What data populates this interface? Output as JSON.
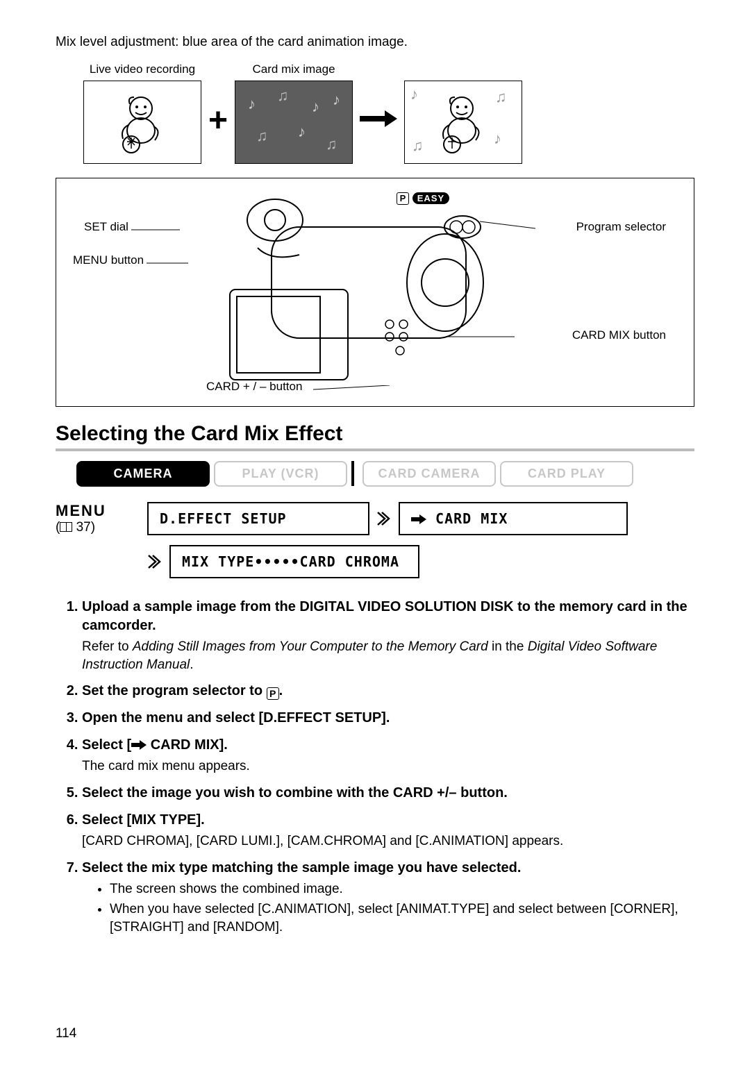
{
  "intro": "Mix level adjustment: blue area of the card animation image.",
  "illus": {
    "label1": "Live video recording",
    "label2": "Card mix image"
  },
  "cam_labels": {
    "set_dial": "SET dial",
    "menu_btn": "MENU button",
    "card_pm": "CARD + / – button",
    "prog_sel": "Program selector",
    "card_mix": "CARD MIX button",
    "p_badge": "P",
    "easy_badge": "EASY"
  },
  "section_heading": "Selecting the Card Mix Effect",
  "modes": {
    "camera": "CAMERA",
    "play": "PLAY (VCR)",
    "card_cam": "CARD CAMERA",
    "card_play": "CARD PLAY"
  },
  "menu": {
    "title": "MENU",
    "ref_page": "37",
    "box1": "D.EFFECT SETUP",
    "box2": "CARD MIX",
    "box3": "MIX TYPE•••••CARD CHROMA"
  },
  "steps": {
    "s1": "Upload a sample image from the DIGITAL VIDEO SOLUTION DISK to the memory card in the camcorder.",
    "s1_sub_a": "Refer to ",
    "s1_sub_i1": "Adding Still Images from Your Computer to the Memory Card",
    "s1_sub_b": " in the ",
    "s1_sub_i2": "Digital Video Software Instruction Manual",
    "s1_sub_c": ".",
    "s2_a": "Set the program selector to ",
    "s2_b": ".",
    "s2_picon": "P",
    "s3": "Open the menu and select [D.EFFECT SETUP].",
    "s4_a": "Select [",
    "s4_b": " CARD MIX].",
    "s4_sub": "The card mix menu appears.",
    "s5": "Select the image you wish to combine with the CARD +/– button.",
    "s6": "Select [MIX TYPE].",
    "s6_sub": "[CARD CHROMA], [CARD LUMI.], [CAM.CHROMA] and [C.ANIMATION] appears.",
    "s7": "Select the mix type matching the sample image you have selected.",
    "s7_b1": "The screen shows the combined image.",
    "s7_b2": "When you have selected [C.ANIMATION], select [ANIMAT.TYPE] and select between [CORNER], [STRAIGHT] and [RANDOM]."
  },
  "page_number": "114"
}
